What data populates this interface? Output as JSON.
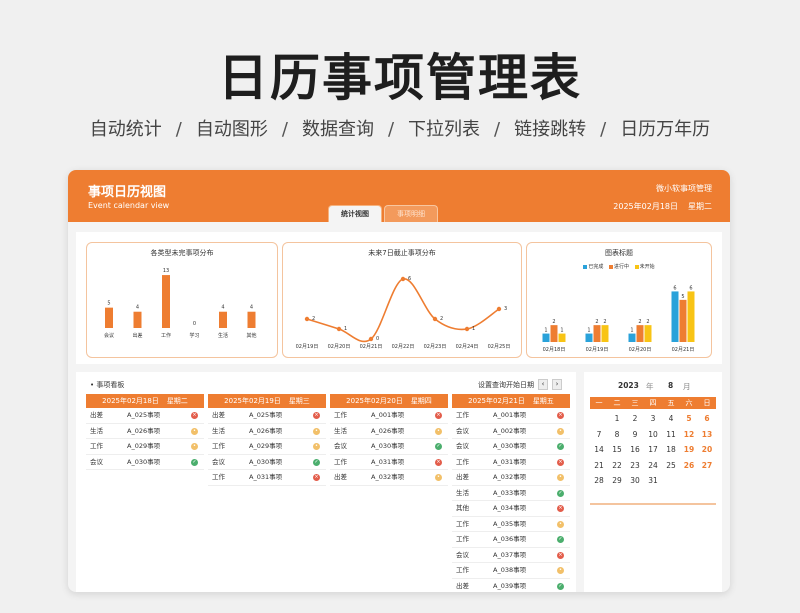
{
  "hero": {
    "title": "日历事项管理表",
    "tags": [
      "自动统计",
      "自动图形",
      "数据查询",
      "下拉列表",
      "链接跳转",
      "日历万年历"
    ],
    "separator": "/"
  },
  "header": {
    "title": "事项日历视图",
    "subtitle": "Event calendar view",
    "brand": "微小软事项管理",
    "date": "2025年02月18日",
    "weekday": "星期二",
    "tabs": [
      "统计视图",
      "事项明细"
    ]
  },
  "colors": {
    "accent": "#ee7d31",
    "blue": "#2aa2da",
    "orange": "#ee7d31",
    "yellow": "#f8c415",
    "red": "#e35d4b",
    "green": "#4bae6d"
  },
  "chart_data": [
    {
      "type": "bar",
      "title": "各类型未完事项分布",
      "categories": [
        "会议",
        "出差",
        "工作",
        "学习",
        "生活",
        "其他"
      ],
      "values": [
        5,
        4,
        13,
        0,
        4,
        4
      ],
      "ylim": [
        0,
        14
      ]
    },
    {
      "type": "line",
      "title": "未来7日截止事项分布",
      "categories": [
        "02月19日",
        "02月20日",
        "02月21日",
        "02月22日",
        "02月23日",
        "02月24日",
        "02月25日"
      ],
      "values": [
        2,
        1,
        0,
        6,
        2,
        1,
        3
      ],
      "ylim": [
        0,
        7
      ]
    },
    {
      "type": "bar",
      "title": "图表标题",
      "categories": [
        "02月18日",
        "02月19日",
        "02月20日",
        "02月21日"
      ],
      "series": [
        {
          "name": "已完成",
          "values": [
            1,
            1,
            1,
            6
          ]
        },
        {
          "name": "进行中",
          "values": [
            2,
            2,
            2,
            5
          ]
        },
        {
          "name": "未开始",
          "values": [
            1,
            2,
            2,
            6
          ]
        }
      ],
      "ylim": [
        0,
        7
      ]
    }
  ],
  "board": {
    "title": "事项看板",
    "date_query_label": "设置查询开始日期",
    "prev": "‹",
    "next": "›",
    "days": [
      {
        "date": "2025年02月18日",
        "weekday": "星期二",
        "events": [
          {
            "cat": "出差",
            "name": "A_025事项",
            "status": "red"
          },
          {
            "cat": "生活",
            "name": "A_026事项",
            "status": "yellow"
          },
          {
            "cat": "工作",
            "name": "A_029事项",
            "status": "yellow"
          },
          {
            "cat": "会议",
            "name": "A_030事项",
            "status": "green"
          }
        ]
      },
      {
        "date": "2025年02月19日",
        "weekday": "星期三",
        "events": [
          {
            "cat": "出差",
            "name": "A_025事项",
            "status": "red"
          },
          {
            "cat": "生活",
            "name": "A_026事项",
            "status": "yellow"
          },
          {
            "cat": "工作",
            "name": "A_029事项",
            "status": "yellow"
          },
          {
            "cat": "会议",
            "name": "A_030事项",
            "status": "green"
          },
          {
            "cat": "工作",
            "name": "A_031事项",
            "status": "red"
          }
        ]
      },
      {
        "date": "2025年02月20日",
        "weekday": "星期四",
        "events": [
          {
            "cat": "工作",
            "name": "A_001事项",
            "status": "red"
          },
          {
            "cat": "生活",
            "name": "A_026事项",
            "status": "yellow"
          },
          {
            "cat": "会议",
            "name": "A_030事项",
            "status": "green"
          },
          {
            "cat": "工作",
            "name": "A_031事项",
            "status": "red"
          },
          {
            "cat": "出差",
            "name": "A_032事项",
            "status": "yellow"
          }
        ]
      },
      {
        "date": "2025年02月21日",
        "weekday": "星期五",
        "events": [
          {
            "cat": "工作",
            "name": "A_001事项",
            "status": "red"
          },
          {
            "cat": "会议",
            "name": "A_002事项",
            "status": "yellow"
          },
          {
            "cat": "会议",
            "name": "A_030事项",
            "status": "green"
          },
          {
            "cat": "工作",
            "name": "A_031事项",
            "status": "red"
          },
          {
            "cat": "出差",
            "name": "A_032事项",
            "status": "yellow"
          },
          {
            "cat": "生活",
            "name": "A_033事项",
            "status": "green"
          },
          {
            "cat": "其他",
            "name": "A_034事项",
            "status": "red"
          },
          {
            "cat": "工作",
            "name": "A_035事项",
            "status": "yellow"
          },
          {
            "cat": "工作",
            "name": "A_036事项",
            "status": "green"
          },
          {
            "cat": "会议",
            "name": "A_037事项",
            "status": "red"
          },
          {
            "cat": "工作",
            "name": "A_038事项",
            "status": "yellow"
          },
          {
            "cat": "出差",
            "name": "A_039事项",
            "status": "green"
          }
        ]
      }
    ]
  },
  "calendar": {
    "year": "2023",
    "year_label": "年",
    "month": "8",
    "month_label": "月",
    "weekdays": [
      "一",
      "二",
      "三",
      "四",
      "五",
      "六",
      "日"
    ],
    "weeks": [
      [
        "",
        "1",
        "2",
        "3",
        "4",
        "5",
        "6"
      ],
      [
        "7",
        "8",
        "9",
        "10",
        "11",
        "12",
        "13"
      ],
      [
        "14",
        "15",
        "16",
        "17",
        "18",
        "19",
        "20"
      ],
      [
        "21",
        "22",
        "23",
        "24",
        "25",
        "26",
        "27"
      ],
      [
        "28",
        "29",
        "30",
        "31",
        "",
        "",
        ""
      ]
    ]
  }
}
